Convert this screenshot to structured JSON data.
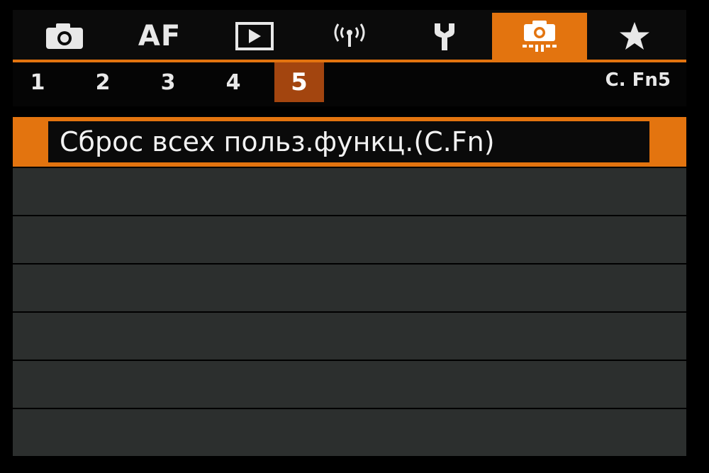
{
  "tabs": [
    {
      "id": "shooting",
      "icon": "camera-icon"
    },
    {
      "id": "af",
      "label": "AF"
    },
    {
      "id": "playback",
      "icon": "playback-icon"
    },
    {
      "id": "wireless",
      "icon": "wireless-icon"
    },
    {
      "id": "setup",
      "icon": "wrench-icon"
    },
    {
      "id": "custom-functions",
      "icon": "custom-function-camera-icon",
      "active": true
    },
    {
      "id": "my-menu",
      "icon": "star-icon"
    }
  ],
  "subtabs": [
    "1",
    "2",
    "3",
    "4",
    "5"
  ],
  "active_subtab": "5",
  "page_code": "C. Fn5",
  "menu_items": [
    {
      "label": "Сброс всех польз.функц.(C.Fn)",
      "selected": true
    }
  ],
  "empty_rows": 6,
  "colors": {
    "accent": "#e3740f",
    "active_subtab": "#a3450f",
    "row_bg": "#2c2f2e"
  }
}
